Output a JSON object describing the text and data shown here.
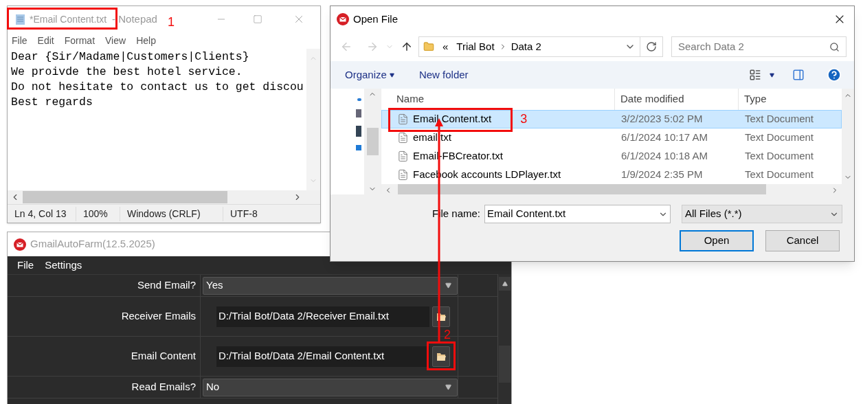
{
  "notepad": {
    "document_title": "*Email Content.txt",
    "app_title": "- Notepad",
    "menu": [
      "File",
      "Edit",
      "Format",
      "View",
      "Help"
    ],
    "lines": [
      "Dear {Sir/Madame|Customers|Clients}",
      "We proivde the best hotel service.",
      "Do not hesitate to contact us to get discou",
      "Best regards"
    ],
    "status_bar": [
      "Ln 4, Col 13",
      "100%",
      "Windows (CRLF)",
      "UTF-8"
    ]
  },
  "open_file_dialog": {
    "title": "Open File",
    "breadcrumb": [
      "«",
      "Trial Bot",
      "Data 2"
    ],
    "search": {
      "placeholder": "Search Data 2"
    },
    "toolbar": [
      "Organize",
      "New folder"
    ],
    "columns": [
      "Name",
      "Date modified",
      "Type"
    ],
    "rows": [
      {
        "name": "Email Content.txt",
        "date": "3/2/2023 5:02 PM",
        "type": "Text Document",
        "selected": true
      },
      {
        "name": "email.txt",
        "date": "6/1/2024 10:17 AM",
        "type": "Text Document",
        "selected": false
      },
      {
        "name": "Email-FBCreator.txt",
        "date": "6/1/2024 10:18 AM",
        "type": "Text Document",
        "selected": false
      },
      {
        "name": "Facebook accounts LDPlayer.txt",
        "date": "1/9/2024 2:35 PM",
        "type": "Text Document",
        "selected": false
      }
    ],
    "file_name_label": "File name:",
    "file_name": "Email Content.txt",
    "file_type": "All Files (*.*)",
    "buttons": [
      "Open",
      "Cancel"
    ]
  },
  "app": {
    "title": "GmailAutoFarm(12.5.2025)",
    "menu": [
      "File",
      "Settings"
    ],
    "settings": [
      {
        "kind": "dropdown",
        "label": "Send Email?",
        "value": "Yes"
      },
      {
        "kind": "path",
        "label": "Receiver Emails",
        "value": "D:/Trial Bot/Data 2/Receiver Email.txt"
      },
      {
        "kind": "path",
        "label": "Email Content",
        "value": "D:/Trial Bot/Data 2/Email Content.txt"
      },
      {
        "kind": "dropdown",
        "label": "Read Emails?",
        "value": "No"
      }
    ]
  },
  "annotations": [
    "1",
    "2",
    "3"
  ]
}
